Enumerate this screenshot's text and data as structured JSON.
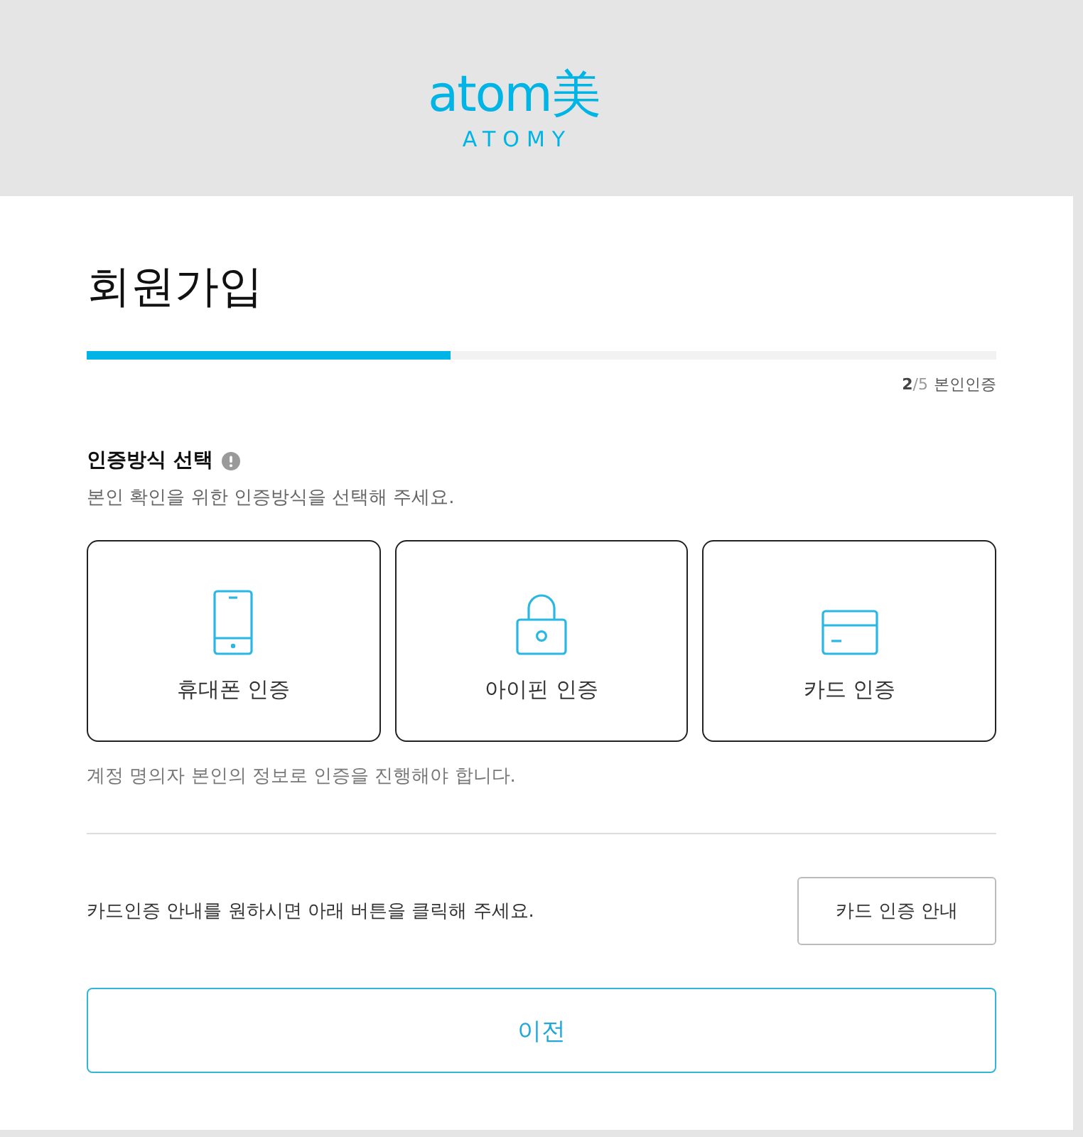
{
  "logo": {
    "mark": "atom美",
    "wordmark": "ATOMY"
  },
  "title": "회원가입",
  "progress": {
    "level": 0.4,
    "step_current": "2",
    "step_total": "/5",
    "step_label": "본인인증"
  },
  "section": {
    "title": "인증방식 선택",
    "description": "본인 확인을 위한 인증방식을 선택해 주세요."
  },
  "methods": [
    {
      "label": "휴대폰 인증",
      "selected": false
    },
    {
      "label": "아이핀 인증",
      "selected": false
    },
    {
      "label": "카드 인증",
      "selected": false
    }
  ],
  "note": "계정 명의자 본인의 정보로 인증을 진행해야 합니다.",
  "card_guide": {
    "text": "카드인증 안내를 원하시면 아래 버튼을 클릭해 주세요.",
    "button": "카드 인증 안내"
  },
  "prev_button": "이전"
}
